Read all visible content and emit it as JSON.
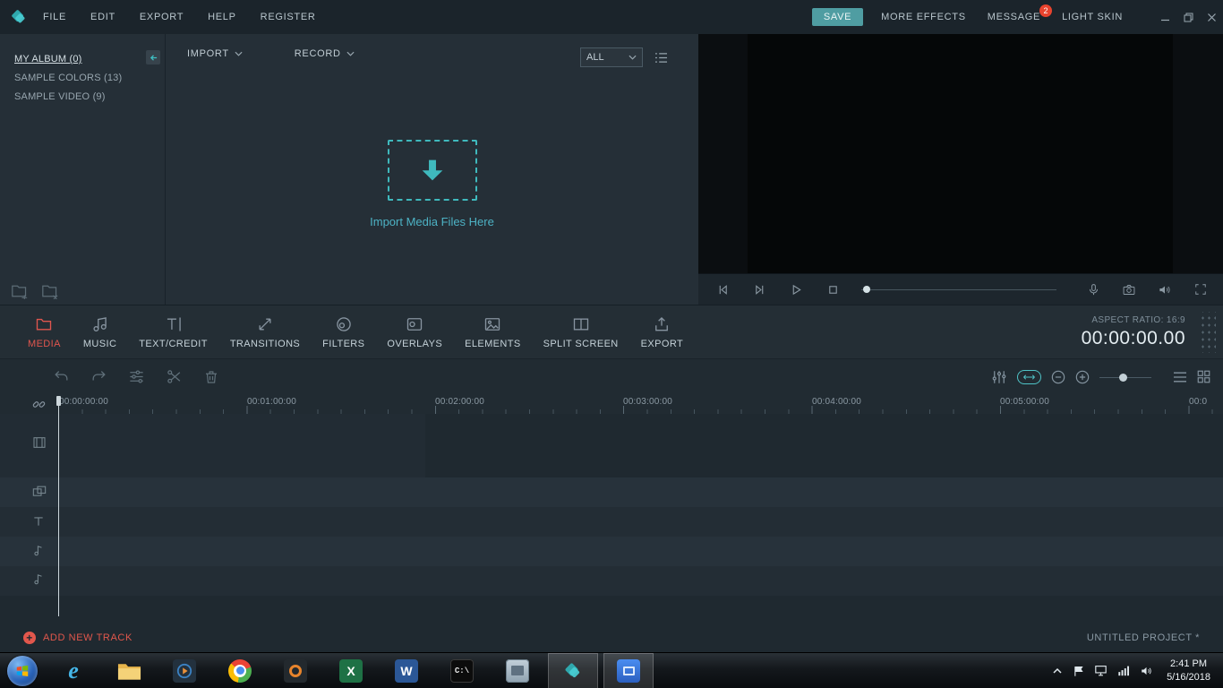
{
  "menubar": {
    "menus": [
      {
        "label": "FILE"
      },
      {
        "label": "EDIT"
      },
      {
        "label": "EXPORT"
      },
      {
        "label": "HELP"
      },
      {
        "label": "REGISTER"
      }
    ],
    "save_label": "SAVE",
    "more_effects_label": "MORE EFFECTS",
    "message_label": "MESSAGE",
    "message_badge": "2",
    "light_skin_label": "LIGHT SKIN"
  },
  "library": {
    "albums": [
      {
        "label": "MY ALBUM (0)",
        "selected": true
      },
      {
        "label": "SAMPLE COLORS (13)",
        "selected": false
      },
      {
        "label": "SAMPLE VIDEO (9)",
        "selected": false
      }
    ]
  },
  "media_browser": {
    "import_label": "IMPORT",
    "record_label": "RECORD",
    "filter_value": "ALL",
    "dropzone_label": "Import Media Files Here"
  },
  "tabs": [
    {
      "label": "MEDIA",
      "icon": "folder-icon",
      "active": true
    },
    {
      "label": "MUSIC",
      "icon": "music-note-icon",
      "active": false
    },
    {
      "label": "TEXT/CREDIT",
      "icon": "text-tool-icon",
      "active": false
    },
    {
      "label": "TRANSITIONS",
      "icon": "transition-icon",
      "active": false
    },
    {
      "label": "FILTERS",
      "icon": "filter-icon",
      "active": false
    },
    {
      "label": "OVERLAYS",
      "icon": "overlay-icon",
      "active": false
    },
    {
      "label": "ELEMENTS",
      "icon": "elements-icon",
      "active": false
    },
    {
      "label": "SPLIT SCREEN",
      "icon": "split-screen-icon",
      "active": false
    },
    {
      "label": "EXPORT",
      "icon": "export-icon",
      "active": false
    }
  ],
  "status": {
    "aspect_ratio_label": "ASPECT RATIO: 16:9",
    "timecode": "00:00:00.00"
  },
  "timeline": {
    "ruler_labels": [
      "00:00:00:00",
      "00:01:00:00",
      "00:02:00:00",
      "00:03:00:00",
      "00:04:00:00",
      "00:05:00:00",
      "00:0"
    ],
    "add_track_label": "ADD NEW TRACK",
    "project_name": "UNTITLED PROJECT *"
  },
  "colors": {
    "accent_teal": "#3fc0c4",
    "accent_red": "#e2574c",
    "save_button_bg": "#4f9da2",
    "badge_red": "#e8432e"
  },
  "taskbar": {
    "apps": [
      {
        "name": "internet-explorer",
        "glyph": "e"
      },
      {
        "name": "file-explorer",
        "glyph": ""
      },
      {
        "name": "media-player",
        "glyph": ""
      },
      {
        "name": "chrome",
        "glyph": ""
      },
      {
        "name": "screen-recorder",
        "glyph": ""
      },
      {
        "name": "excel",
        "glyph": "X"
      },
      {
        "name": "word",
        "glyph": "W"
      },
      {
        "name": "command-prompt",
        "glyph": "C:\\"
      },
      {
        "name": "snipping-tool",
        "glyph": ""
      },
      {
        "name": "filmora",
        "glyph": ""
      },
      {
        "name": "filmora-scrn",
        "glyph": ""
      }
    ],
    "clock_time": "2:41 PM",
    "clock_date": "5/16/2018"
  }
}
